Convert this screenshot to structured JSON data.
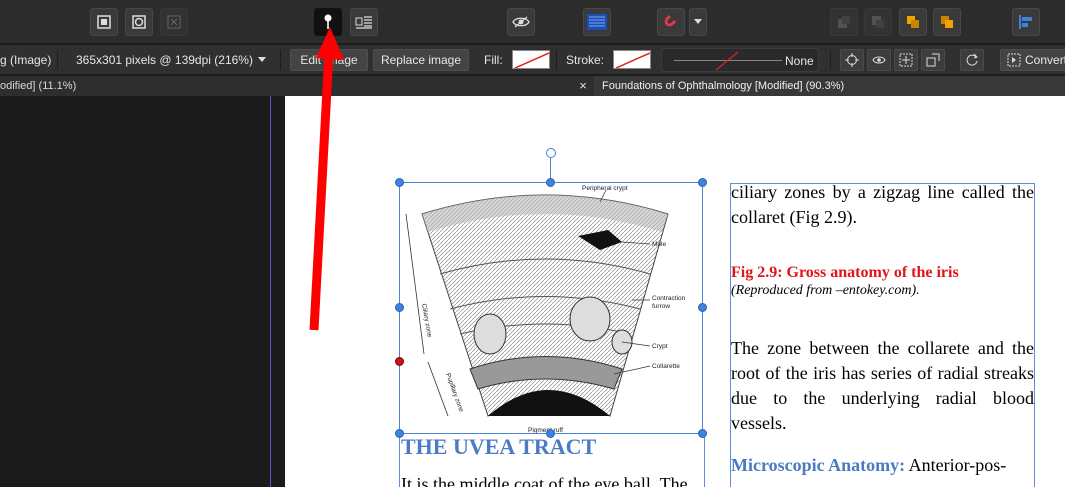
{
  "toolbar": {
    "buttons": [
      {
        "name": "document-icon",
        "label": ""
      },
      {
        "name": "frame-icon",
        "label": ""
      },
      {
        "name": "disabled-icon",
        "label": ""
      },
      {
        "name": "pin-icon",
        "label": ""
      },
      {
        "name": "text-wrap-icon",
        "label": ""
      },
      {
        "name": "view-icon",
        "label": ""
      },
      {
        "name": "baseline-grid-icon",
        "label": ""
      },
      {
        "name": "magnet-icon",
        "label": ""
      },
      {
        "name": "arrange-back-icon",
        "label": ""
      },
      {
        "name": "arrange-backward-icon",
        "label": ""
      },
      {
        "name": "arrange-forward-icon",
        "label": ""
      },
      {
        "name": "arrange-front-icon",
        "label": ""
      },
      {
        "name": "align-icon",
        "label": ""
      }
    ],
    "accent": "#e8364a"
  },
  "context": {
    "object_type": "g (Image)",
    "image_info": "365x301 pixels @ 139dpi (216%)",
    "edit_image": "Edit Image",
    "replace_image": "Replace image",
    "fill_label": "Fill:",
    "stroke_label": "Stroke:",
    "stroke_style": "None",
    "convert": "Convert"
  },
  "tabs": [
    {
      "label": "odified] (11.1%)"
    },
    {
      "label": "Foundations of Ophthalmology [Modified] (90.3%)"
    }
  ],
  "tab_close": "×",
  "page": {
    "col2_p1": "ciliary zones by a zigzag line called the collaret (Fig 2.9).",
    "caption_title": "Fig 2.9: Gross anatomy of the iris",
    "caption_sub": "(Reproduced from –entokey.com).",
    "col2_p2": "The zone between the collarete and the root of the iris has series of radial streaks due to the underlying radial blood vessels.",
    "micro_heading": "Microscopic Anatomy:",
    "micro_text": " Anterior-pos-",
    "uvea_title": "THE UVEA TRACT",
    "uvea_body": "It is the middle coat of the eye ball. The"
  },
  "figure_labels": {
    "peripheral": "Peripheral crypt",
    "mole": "Mole",
    "contraction": "Contraction",
    "furrow": "furrow",
    "crypt": "Crypt",
    "collarette": "Collarette",
    "ruff": "Pigment ruff",
    "ciliary": "Ciliary zone",
    "pupillary": "Pupillary zone"
  }
}
